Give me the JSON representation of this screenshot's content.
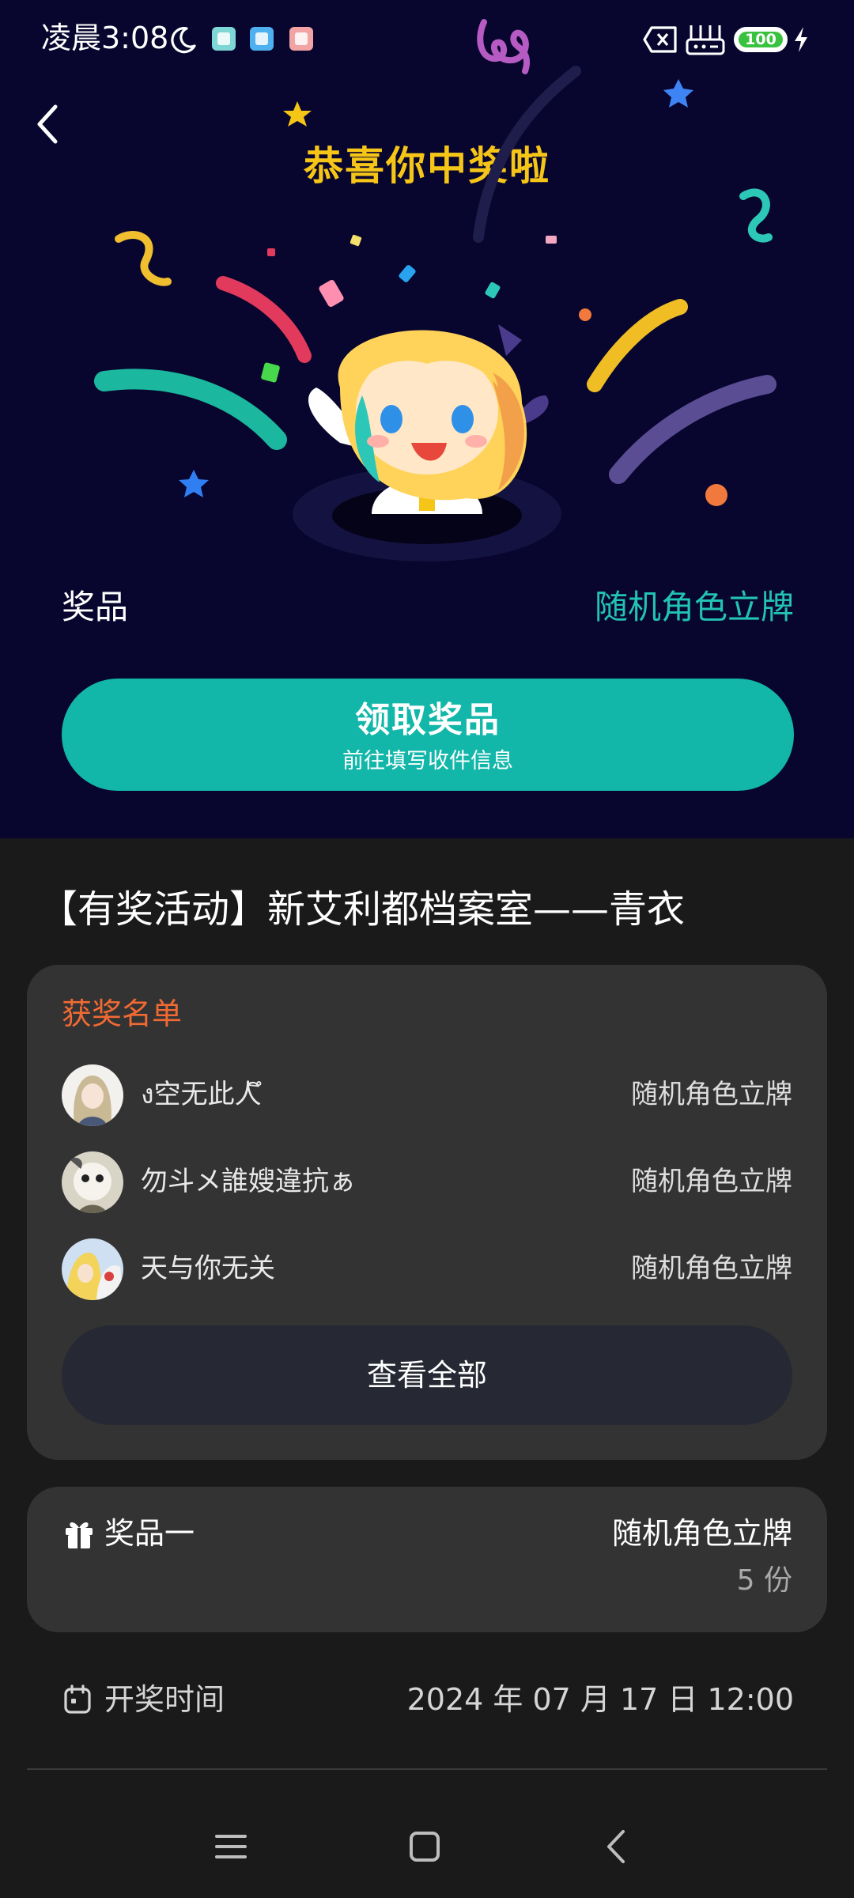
{
  "status_bar": {
    "time": "凌晨3:08",
    "battery": "100"
  },
  "hero": {
    "title": "恭喜你中奖啦",
    "prize_label": "奖品",
    "prize_value": "随机角色立牌",
    "claim_button": {
      "label": "领取奖品",
      "sublabel": "前往填写收件信息"
    }
  },
  "event": {
    "title": "【有奖活动】新艾利都档案室——青衣"
  },
  "winners": {
    "heading": "获奖名单",
    "list": [
      {
        "name": "ง空无此人ึ",
        "prize": "随机角色立牌"
      },
      {
        "name": "勿斗メ誰嫂違抗ぁ",
        "prize": "随机角色立牌"
      },
      {
        "name": "天与你无关",
        "prize": "随机角色立牌"
      }
    ],
    "view_all": "查看全部"
  },
  "prize_card": {
    "label": "奖品一",
    "name": "随机角色立牌",
    "quantity": "5 份"
  },
  "draw": {
    "label": "开奖时间",
    "time": "2024 年 07 月 17 日 12:00"
  },
  "colors": {
    "hero_bg": "#08062e",
    "accent_teal": "#12b7a9",
    "title_gold": "#f5c518",
    "winners_heading": "#f26a33",
    "page_bg": "#1a1a1a",
    "card_bg": "#333333"
  }
}
